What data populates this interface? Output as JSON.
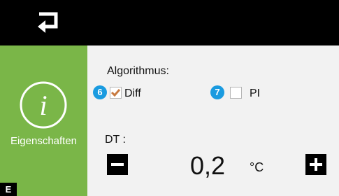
{
  "sidebar": {
    "label": "Eigenschaften",
    "badge": "E"
  },
  "algorithm": {
    "label": "Algorithmus:",
    "options": [
      {
        "marker": "6",
        "label": "Diff",
        "checked": true
      },
      {
        "marker": "7",
        "label": "PI",
        "checked": false
      }
    ]
  },
  "dt": {
    "label": "DT :",
    "value": "0,2",
    "unit": "°C"
  },
  "colors": {
    "accent": "#7ab648",
    "marker": "#1a9be0",
    "check": "#c87a40"
  },
  "icons": [
    "back-arrow-icon",
    "info-icon",
    "minus-icon",
    "plus-icon"
  ]
}
